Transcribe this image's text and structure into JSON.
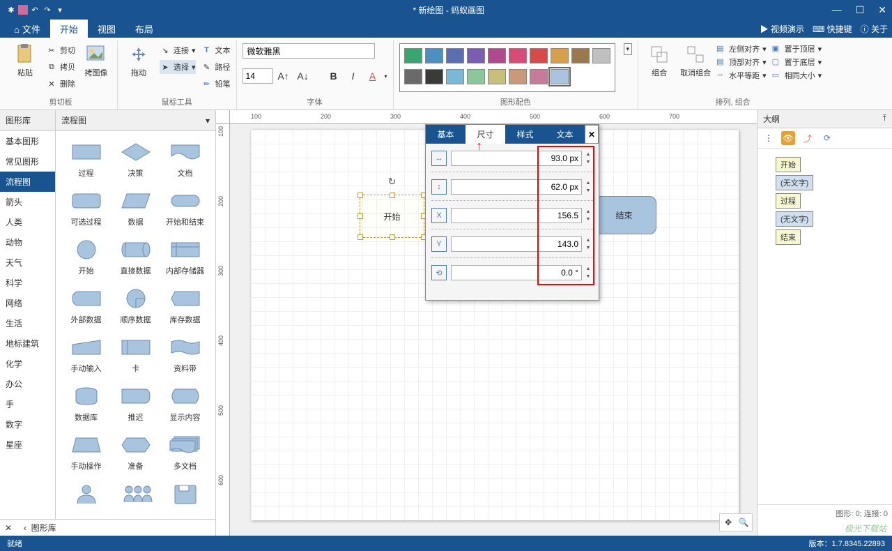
{
  "title": "* 新绘图 - 蚂蚁画图",
  "menu": {
    "file": "文件",
    "start": "开始",
    "view": "视图",
    "layout": "布局",
    "video": "视频演示",
    "shortcut": "快捷键",
    "about": "关于"
  },
  "ribbon": {
    "clipboard": {
      "paste": "粘贴",
      "cut": "剪切",
      "copy": "拷贝",
      "image": "拷图像",
      "delete": "删除",
      "label": "剪切板"
    },
    "mouse": {
      "drag": "拖动",
      "connect": "连接",
      "select": "选择",
      "text": "文本",
      "path": "路径",
      "pencil": "铅笔",
      "label": "鼠标工具"
    },
    "font": {
      "name": "微软雅黑",
      "size": "14",
      "label": "字体"
    },
    "color": {
      "label": "图形配色"
    },
    "arrange": {
      "group": "组合",
      "ungroup": "取消组合",
      "alignLeft": "左侧对齐",
      "top": "置于顶层",
      "alignTop": "顶部对齐",
      "bottom": "置于底层",
      "hdist": "水平等距",
      "sameSize": "相同大小",
      "label": "排列, 组合"
    }
  },
  "leftPanel": {
    "catHeader": "图形库",
    "shapeHeader": "流程图",
    "categories": [
      "基本图形",
      "常见图形",
      "流程图",
      "箭头",
      "人类",
      "动物",
      "天气",
      "科学",
      "网络",
      "生活",
      "地标建筑",
      "化学",
      "办公",
      "手",
      "数字",
      "星座"
    ],
    "activeCategory": 2,
    "shapes": [
      "过程",
      "决策",
      "文档",
      "可选过程",
      "数据",
      "开始和结束",
      "开始",
      "直接数据",
      "内部存储器",
      "外部数据",
      "顺序数据",
      "库存数据",
      "手动输入",
      "卡",
      "资料带",
      "数据库",
      "推迟",
      "显示内容",
      "手动操作",
      "准备",
      "多文档"
    ],
    "back": "图形库"
  },
  "canvas": {
    "startShape": "开始",
    "endShape": "结束",
    "hTicks": [
      "100",
      "200",
      "300",
      "400",
      "500",
      "600",
      "700"
    ],
    "vTicks": [
      "100",
      "200",
      "300",
      "400",
      "500",
      "600"
    ]
  },
  "propPanel": {
    "tabs": [
      "基本",
      "尺寸",
      "样式",
      "文本"
    ],
    "activeTab": 1,
    "width": "93.0 px",
    "height": "62.0 px",
    "x": "156.5",
    "y": "143.0",
    "rotation": "0.0 °"
  },
  "outline": {
    "header": "大纲",
    "items": [
      {
        "label": "开始",
        "blue": false
      },
      {
        "label": "(无文字)",
        "blue": true
      },
      {
        "label": "过程",
        "blue": false
      },
      {
        "label": "(无文字)",
        "blue": true
      },
      {
        "label": "结束",
        "blue": false
      }
    ],
    "status": "图形: 0; 连接: 0"
  },
  "status": {
    "ready": "就绪",
    "version": "版本：1.7.8345.22893"
  },
  "watermark": "极光下载站",
  "colors": [
    "#3aa66f",
    "#4a90c0",
    "#5a6fb0",
    "#7a5fb0",
    "#b04a90",
    "#d84a7a",
    "#d84a4a",
    "#d8a04a",
    "#9a7a4a",
    "#c0c0c0",
    "#6a6a6a",
    "#3a3a3a",
    "#7ab8d8",
    "#8ac89a",
    "#c8c07a",
    "#c89a7a",
    "#c87a9a",
    "#a8c4de"
  ]
}
